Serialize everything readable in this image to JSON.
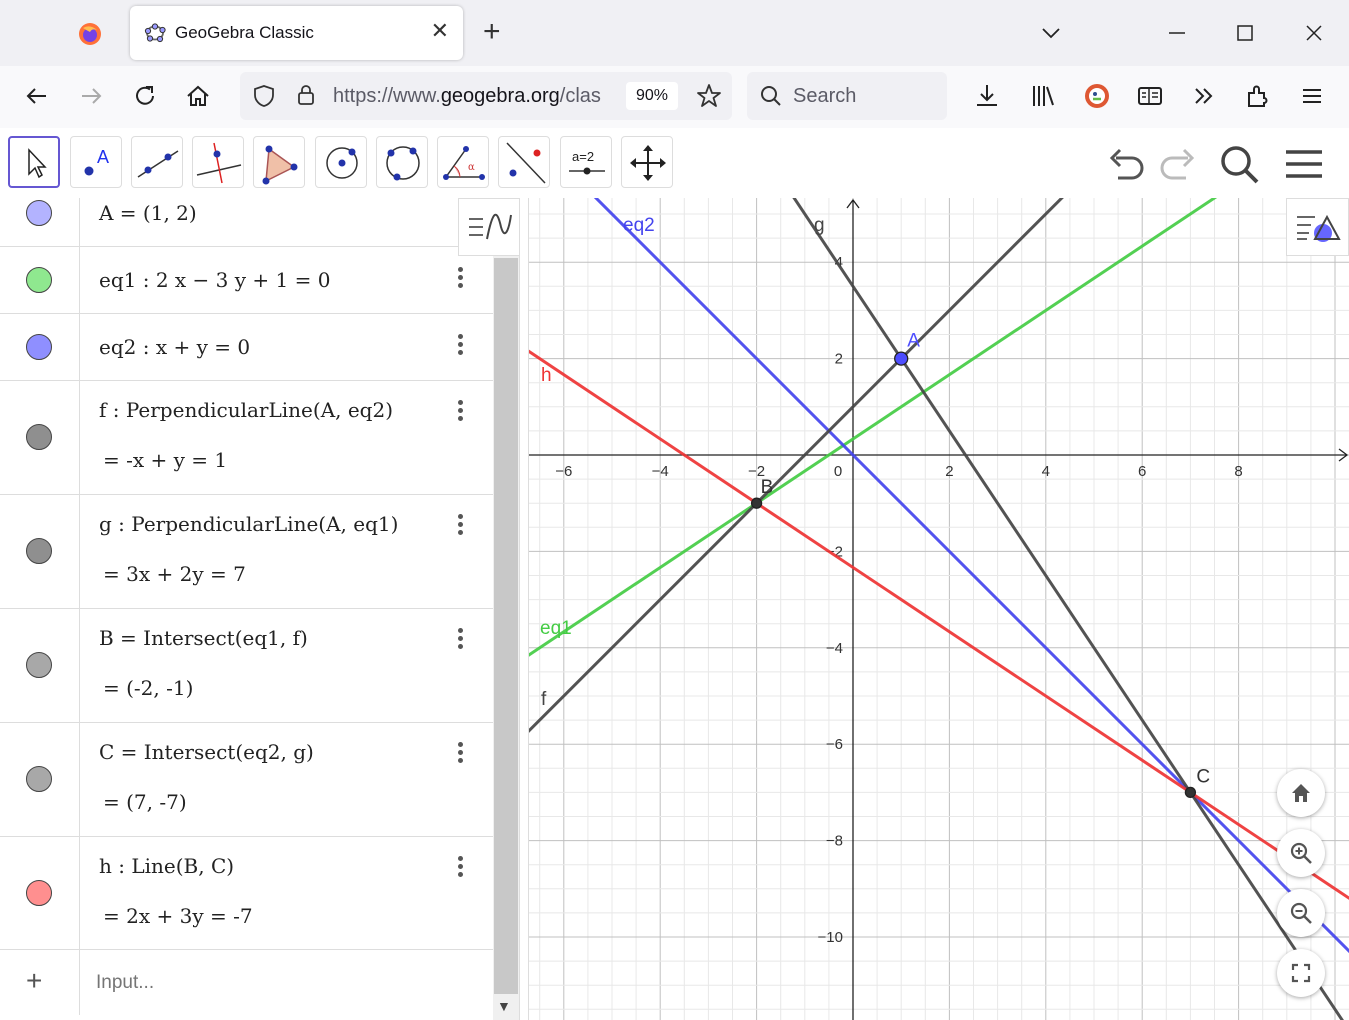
{
  "browser": {
    "tab_title": "GeoGebra Classic",
    "url_prefix": "https://www.",
    "url_domain": "geogebra.org",
    "url_suffix": "/clas",
    "zoom": "90%",
    "search_placeholder": "Search"
  },
  "algebra": {
    "rows": [
      {
        "definition": "A = (1, 2)",
        "value": "",
        "color": "#b3b3ff"
      },
      {
        "definition": "eq1 : 2 x − 3 y + 1 = 0",
        "value": "",
        "color": "#8fe88f"
      },
      {
        "definition": "eq2 : x + y = 0",
        "value": "",
        "color": "#8f8fff"
      },
      {
        "definition": "f : PerpendicularLine(A, eq2)",
        "value": "=  -x + y = 1",
        "color": "#8f8f8f"
      },
      {
        "definition": "g : PerpendicularLine(A, eq1)",
        "value": "=  3x + 2y = 7",
        "color": "#8f8f8f"
      },
      {
        "definition": "B = Intersect(eq1, f)",
        "value": "=  (-2, -1)",
        "color": "#a8a8a8"
      },
      {
        "definition": "C = Intersect(eq2, g)",
        "value": "=  (7, -7)",
        "color": "#a8a8a8"
      },
      {
        "definition": "h : Line(B, C)",
        "value": "=  2x + 3y = -7",
        "color": "#ff8f8f"
      }
    ],
    "input_placeholder": "Input...",
    "input_plus": "+"
  },
  "graphics": {
    "x_ticks": [
      "−6",
      "−4",
      "−2",
      "0",
      "2",
      "4",
      "6",
      "8"
    ],
    "y_ticks": [
      "4",
      "2",
      "−2",
      "−4",
      "−6",
      "−8",
      "−10"
    ],
    "labels": {
      "eq1": "eq1",
      "eq2": "eq2",
      "f": "f",
      "g": "g",
      "h": "h",
      "A": "A",
      "B": "B",
      "C": "C"
    },
    "colors": {
      "eq1": "#44cc44",
      "eq2": "#4444ee",
      "f": "#444444",
      "g": "#444444",
      "h": "#ee3333",
      "pointA": "#4d4dff",
      "point": "#333333"
    },
    "points": {
      "A": [
        1,
        2
      ],
      "B": [
        -2,
        -1
      ],
      "C": [
        7,
        -7
      ]
    },
    "lines": {
      "eq1": {
        "a": 2,
        "b": -3,
        "c": 1
      },
      "eq2": {
        "a": 1,
        "b": 1,
        "c": 0
      },
      "f": {
        "a": -1,
        "b": 1,
        "c": -1
      },
      "g": {
        "a": 3,
        "b": 2,
        "c": -7
      },
      "h": {
        "a": 2,
        "b": 3,
        "c": 7
      }
    }
  }
}
